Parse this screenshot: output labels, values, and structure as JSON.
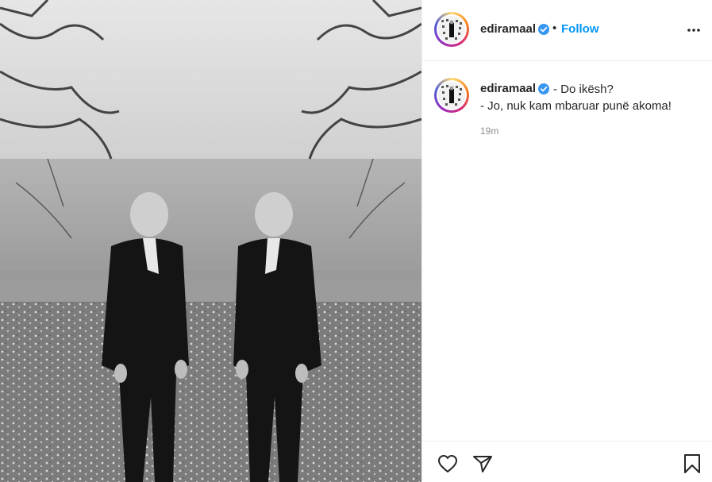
{
  "post": {
    "photo_alt": "",
    "author": {
      "username": "ediramaal",
      "verified_icon": "verified-badge-icon",
      "follow_label": "Follow",
      "separator": "•"
    },
    "caption": {
      "username": "ediramaal",
      "line1": "- Do ikësh?",
      "line2": "- Jo, nuk kam mbaruar punë akoma!"
    },
    "timestamp": "19m",
    "icons": {
      "more": "more-options-icon",
      "like": "heart-icon",
      "share": "paper-plane-icon",
      "save": "bookmark-icon"
    },
    "colors": {
      "accent": "#0095f6",
      "verified": "#3897f0",
      "text": "#262626",
      "muted": "#8e8e8e"
    }
  }
}
